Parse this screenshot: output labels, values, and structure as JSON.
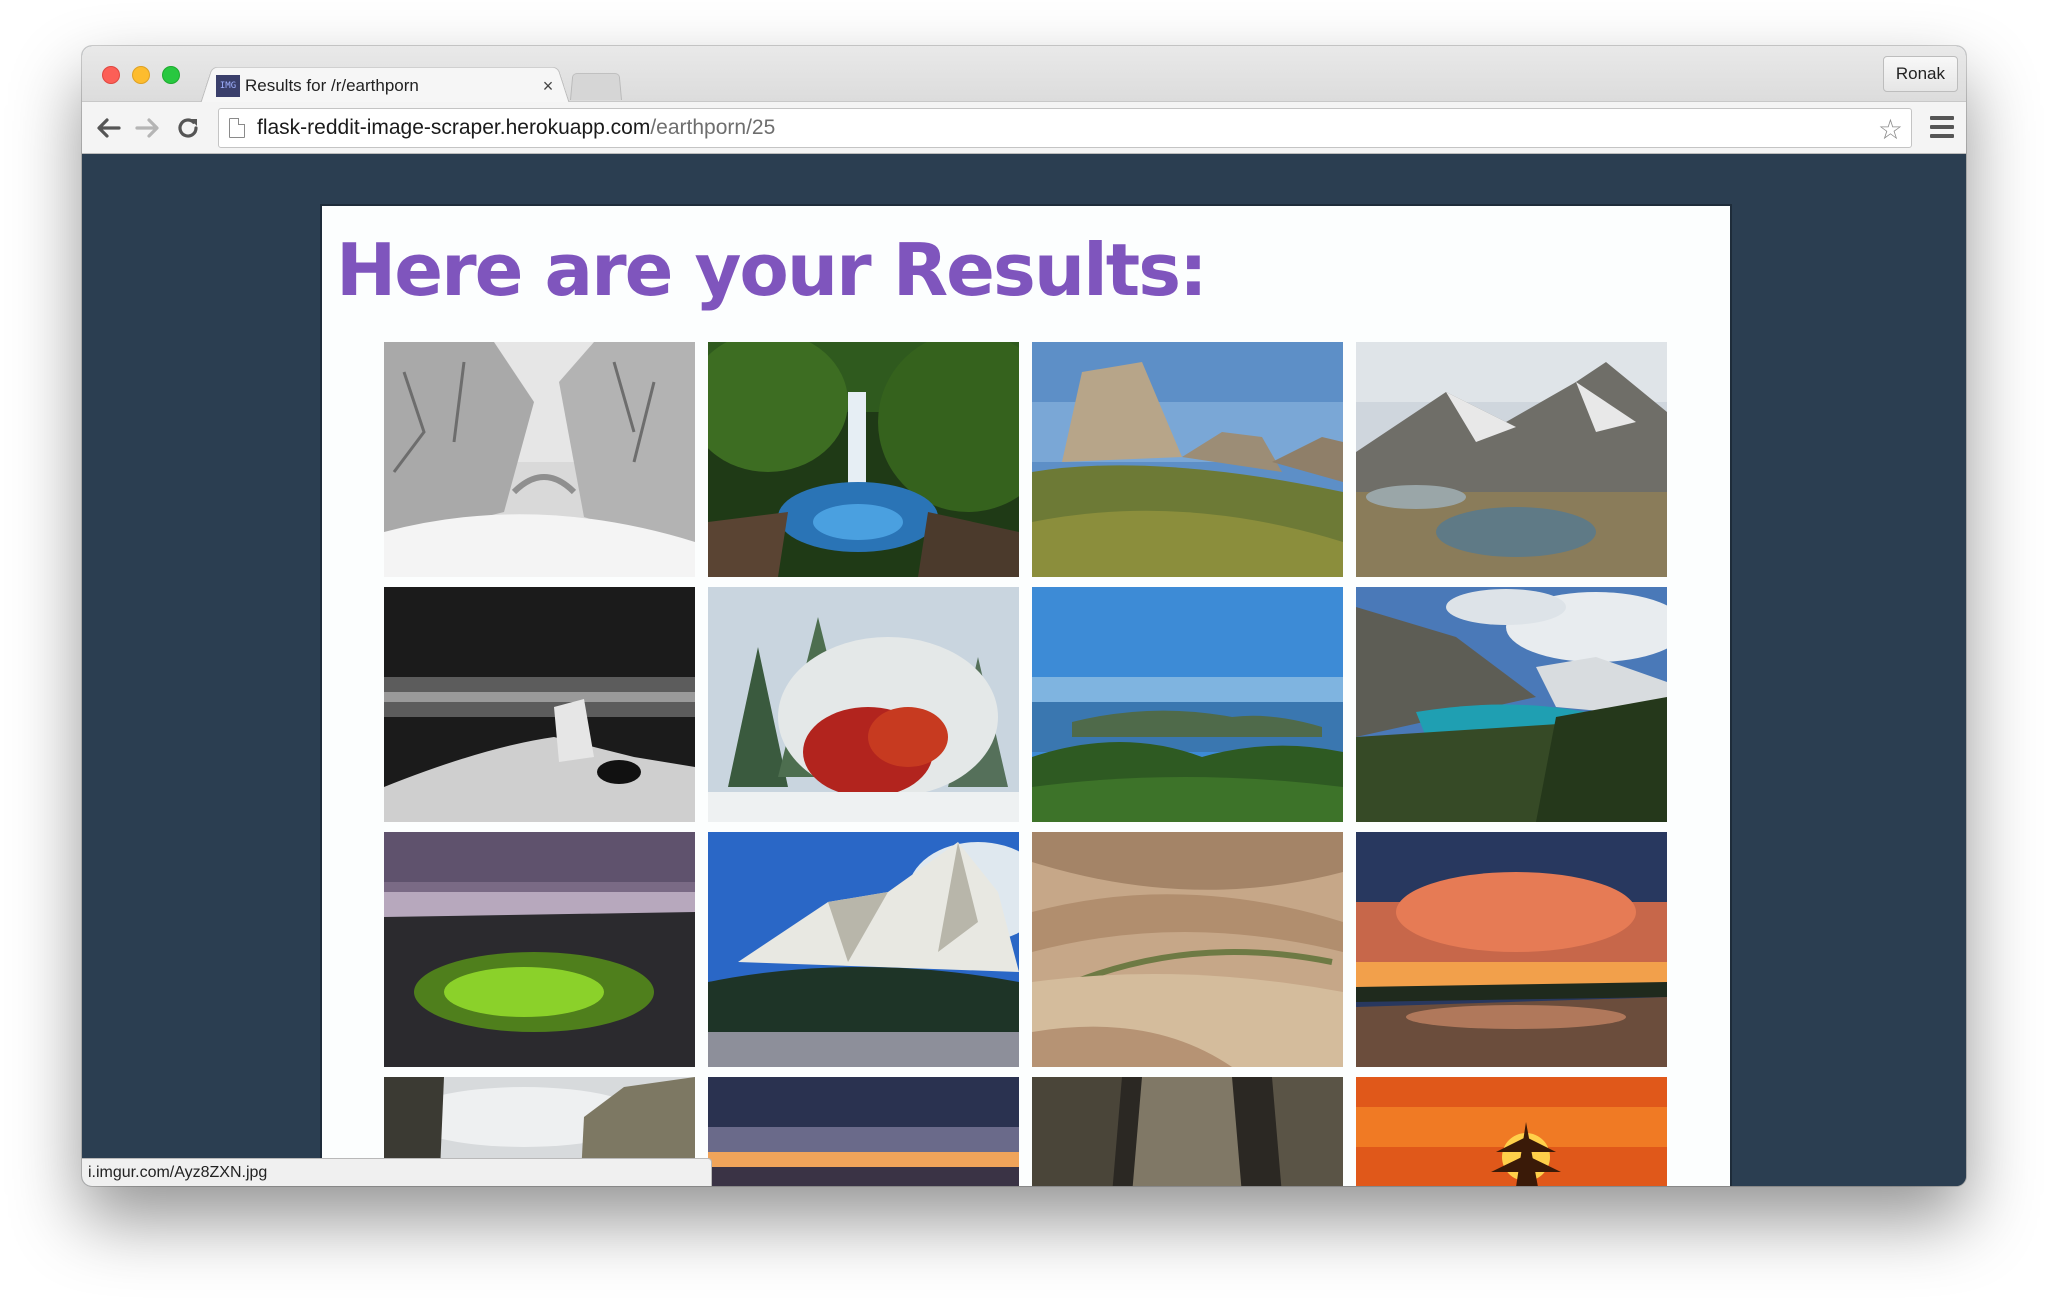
{
  "browser": {
    "tab": {
      "favicon_text": "IMG",
      "title": "Results for /r/earthporn",
      "close_glyph": "×"
    },
    "profile_name": "Ronak",
    "address": {
      "host": "flask-reddit-image-scraper.herokuapp.com",
      "path": "/earthporn/25"
    },
    "icons": {
      "back": "back-arrow-icon",
      "forward": "forward-arrow-icon",
      "reload": "reload-icon",
      "page": "page-icon",
      "star": "star-icon",
      "menu": "hamburger-menu-icon"
    },
    "status_url": "i.imgur.com/Ayz8ZXN.jpg"
  },
  "page": {
    "heading": "Here are your Results:"
  },
  "images": [
    {
      "scene": "snow-forest"
    },
    {
      "scene": "waterfall"
    },
    {
      "scene": "mesa-cliff"
    },
    {
      "scene": "alpine-lake"
    },
    {
      "scene": "bw-summit"
    },
    {
      "scene": "snow-red-tree"
    },
    {
      "scene": "coastal-islands"
    },
    {
      "scene": "turquoise-lake"
    },
    {
      "scene": "green-pool-dusk"
    },
    {
      "scene": "flatirons-snow"
    },
    {
      "scene": "desert-canyon"
    },
    {
      "scene": "sunset-beach"
    },
    {
      "scene": "rock-cliff-sky"
    },
    {
      "scene": "grand-canyon-sunrise"
    },
    {
      "scene": "slot-canyon"
    },
    {
      "scene": "orange-sunset-tree"
    }
  ]
}
